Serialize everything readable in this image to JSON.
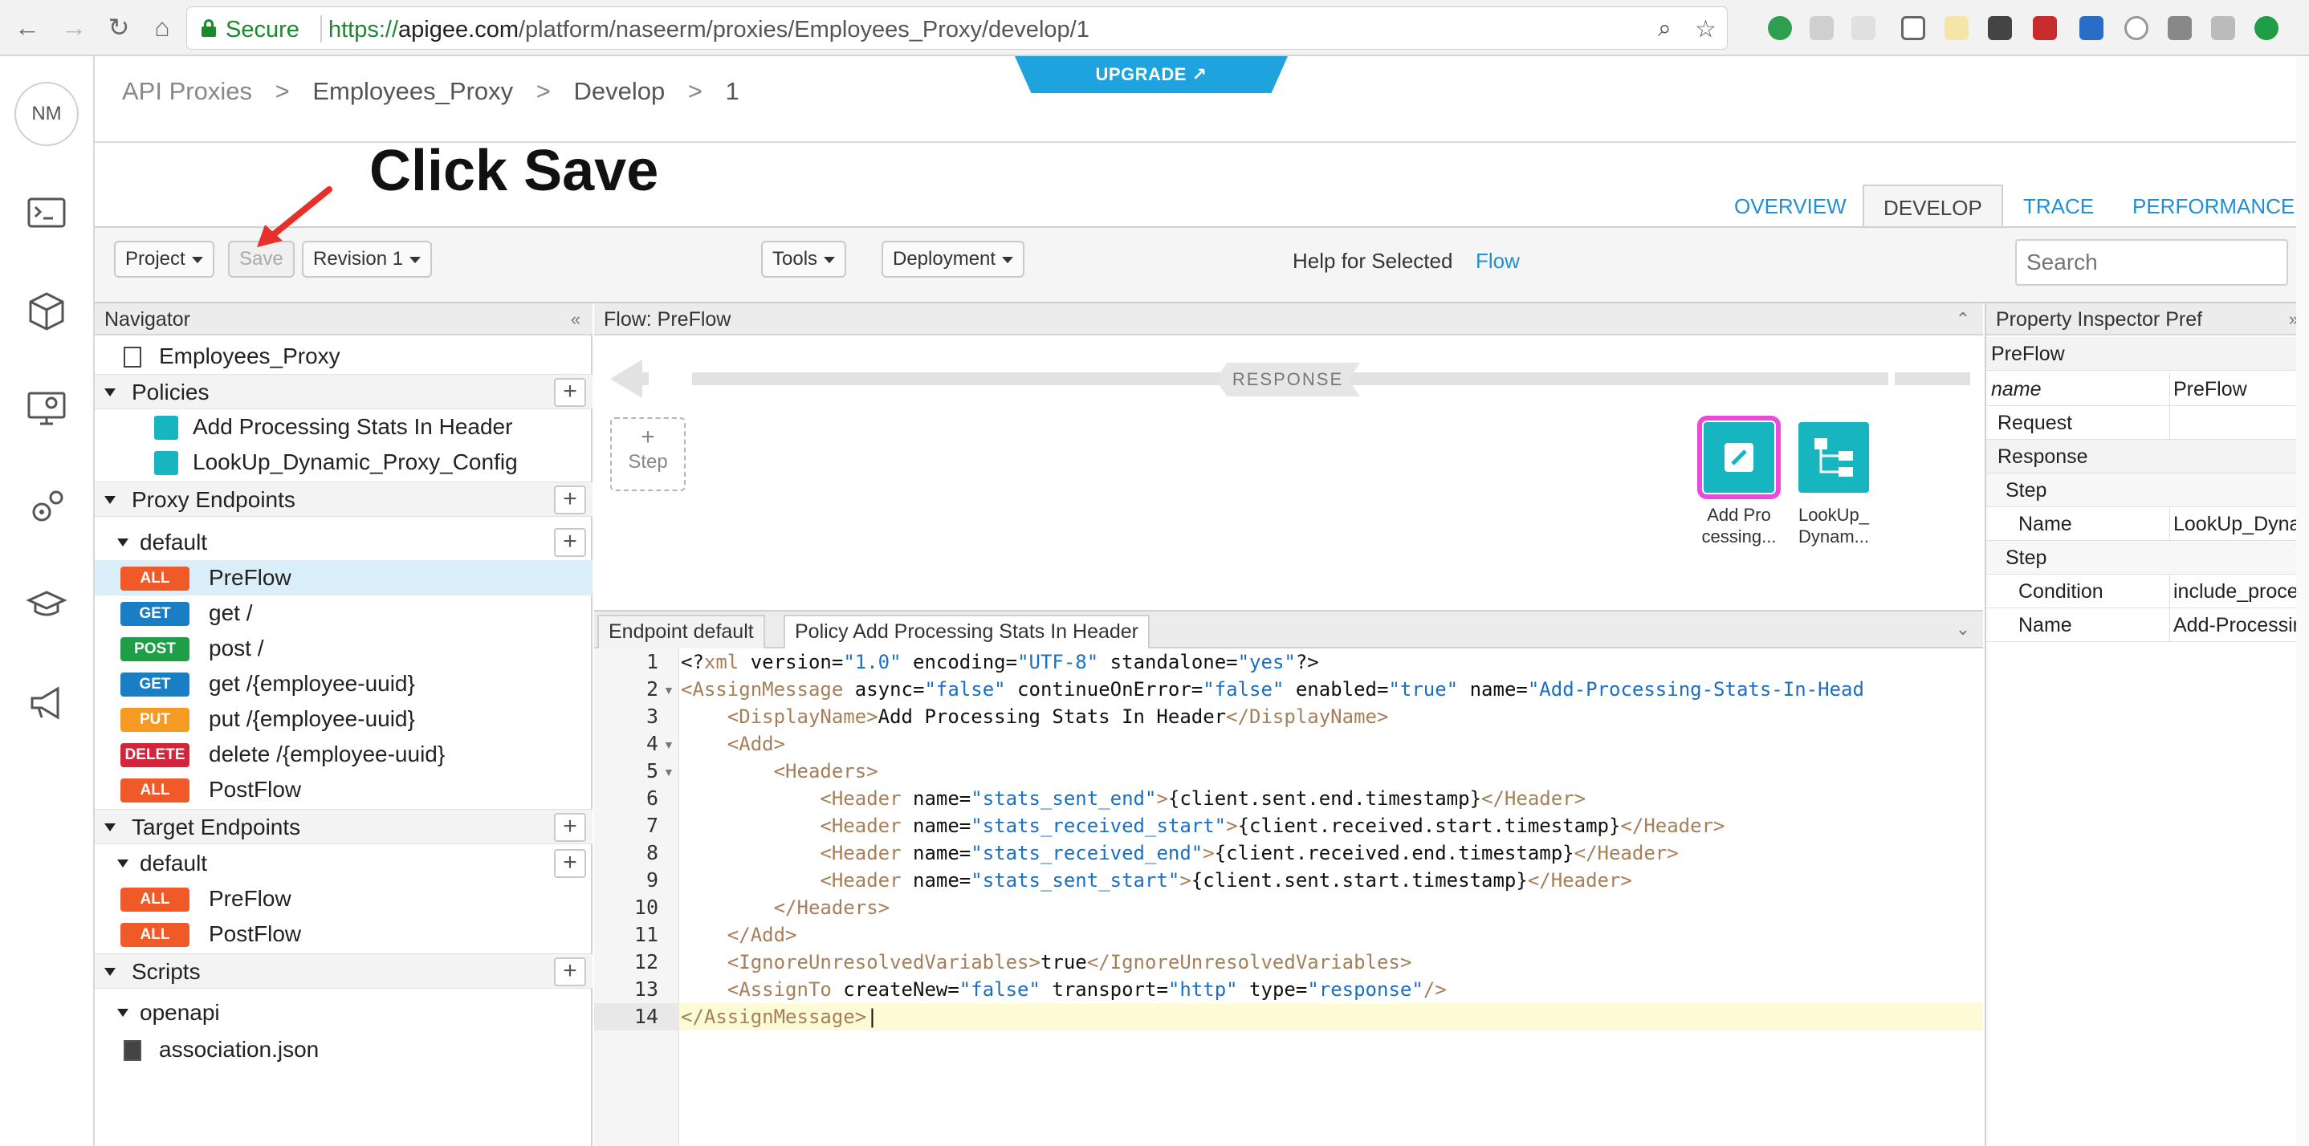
{
  "browser": {
    "secure_label": "Secure",
    "url_scheme": "https://",
    "url_host": "apigee.com",
    "url_path": "/platform/naseerm/proxies/Employees_Proxy/develop/1"
  },
  "upgrade": {
    "label": "UPGRADE ↗"
  },
  "avatar": {
    "initials": "NM"
  },
  "breadcrumb": {
    "items": [
      "API Proxies",
      ">",
      "Employees_Proxy",
      ">",
      "Develop",
      ">",
      "1"
    ]
  },
  "annotation": {
    "text": "Click Save"
  },
  "top_tabs": {
    "overview": "OVERVIEW",
    "develop": "DEVELOP",
    "trace": "TRACE",
    "performance": "PERFORMANCE"
  },
  "toolbar": {
    "project": "Project",
    "save": "Save",
    "revision": "Revision 1",
    "tools": "Tools",
    "deployment": "Deployment",
    "help_text": "Help for Selected",
    "help_link": "Flow",
    "search_placeholder": "Search"
  },
  "navigator": {
    "title": "Navigator",
    "collapse": "«",
    "proxy_name": "Employees_Proxy",
    "policies_label": "Policies",
    "policies": [
      "Add Processing Stats In Header",
      "LookUp_Dynamic_Proxy_Config"
    ],
    "proxy_endpoints_label": "Proxy Endpoints",
    "proxy_default": "default",
    "proxy_flows": [
      {
        "verb": "ALL",
        "label": "PreFlow"
      },
      {
        "verb": "GET",
        "label": "get /"
      },
      {
        "verb": "POST",
        "label": "post /"
      },
      {
        "verb": "GET",
        "label": "get /{employee-uuid}"
      },
      {
        "verb": "PUT",
        "label": "put /{employee-uuid}"
      },
      {
        "verb": "DELETE",
        "label": "delete /{employee-uuid}"
      },
      {
        "verb": "ALL",
        "label": "PostFlow"
      }
    ],
    "target_endpoints_label": "Target Endpoints",
    "target_default": "default",
    "target_flows": [
      {
        "verb": "ALL",
        "label": "PreFlow"
      },
      {
        "verb": "ALL",
        "label": "PostFlow"
      }
    ],
    "scripts_label": "Scripts",
    "scripts_folder": "openapi",
    "scripts_file": "association.json",
    "plus": "+"
  },
  "flow": {
    "title": "Flow: PreFlow",
    "response_label": "RESPONSE",
    "step_plus": "+",
    "step_label": "Step",
    "tile1_line1": "Add Pro",
    "tile1_line2": "cessing...",
    "tile2_line1": "LookUp_",
    "tile2_line2": "Dynam..."
  },
  "editor": {
    "tab_endpoint": "Endpoint default",
    "tab_policy": "Policy Add Processing Stats In Header",
    "line_numbers": [
      "1",
      "2",
      "3",
      "4",
      "5",
      "6",
      "7",
      "8",
      "9",
      "10",
      "11",
      "12",
      "13",
      "14"
    ]
  },
  "inspector": {
    "title": "Property Inspector  Pref",
    "expand": "»",
    "rows": [
      {
        "label": "PreFlow",
        "value": ""
      },
      {
        "label": "name",
        "value": "PreFlow"
      },
      {
        "label": "Request",
        "value": ""
      },
      {
        "label": "Response",
        "value": ""
      },
      {
        "label": "Step",
        "value": ""
      },
      {
        "label": "Name",
        "value": "LookUp_Dyna"
      },
      {
        "label": "Step",
        "value": ""
      },
      {
        "label": "Condition",
        "value": "include_proce"
      },
      {
        "label": "Name",
        "value": "Add-Processin"
      }
    ]
  },
  "colors": {
    "accent_blue": "#1f8fd6",
    "verb_all": "#f05a28",
    "verb_get": "#1a7ec4",
    "verb_post": "#1f9e47",
    "verb_put": "#f59a23",
    "verb_delete": "#d3263a",
    "policy_teal": "#17b5c0",
    "selection_pink": "#ea4bd9"
  }
}
